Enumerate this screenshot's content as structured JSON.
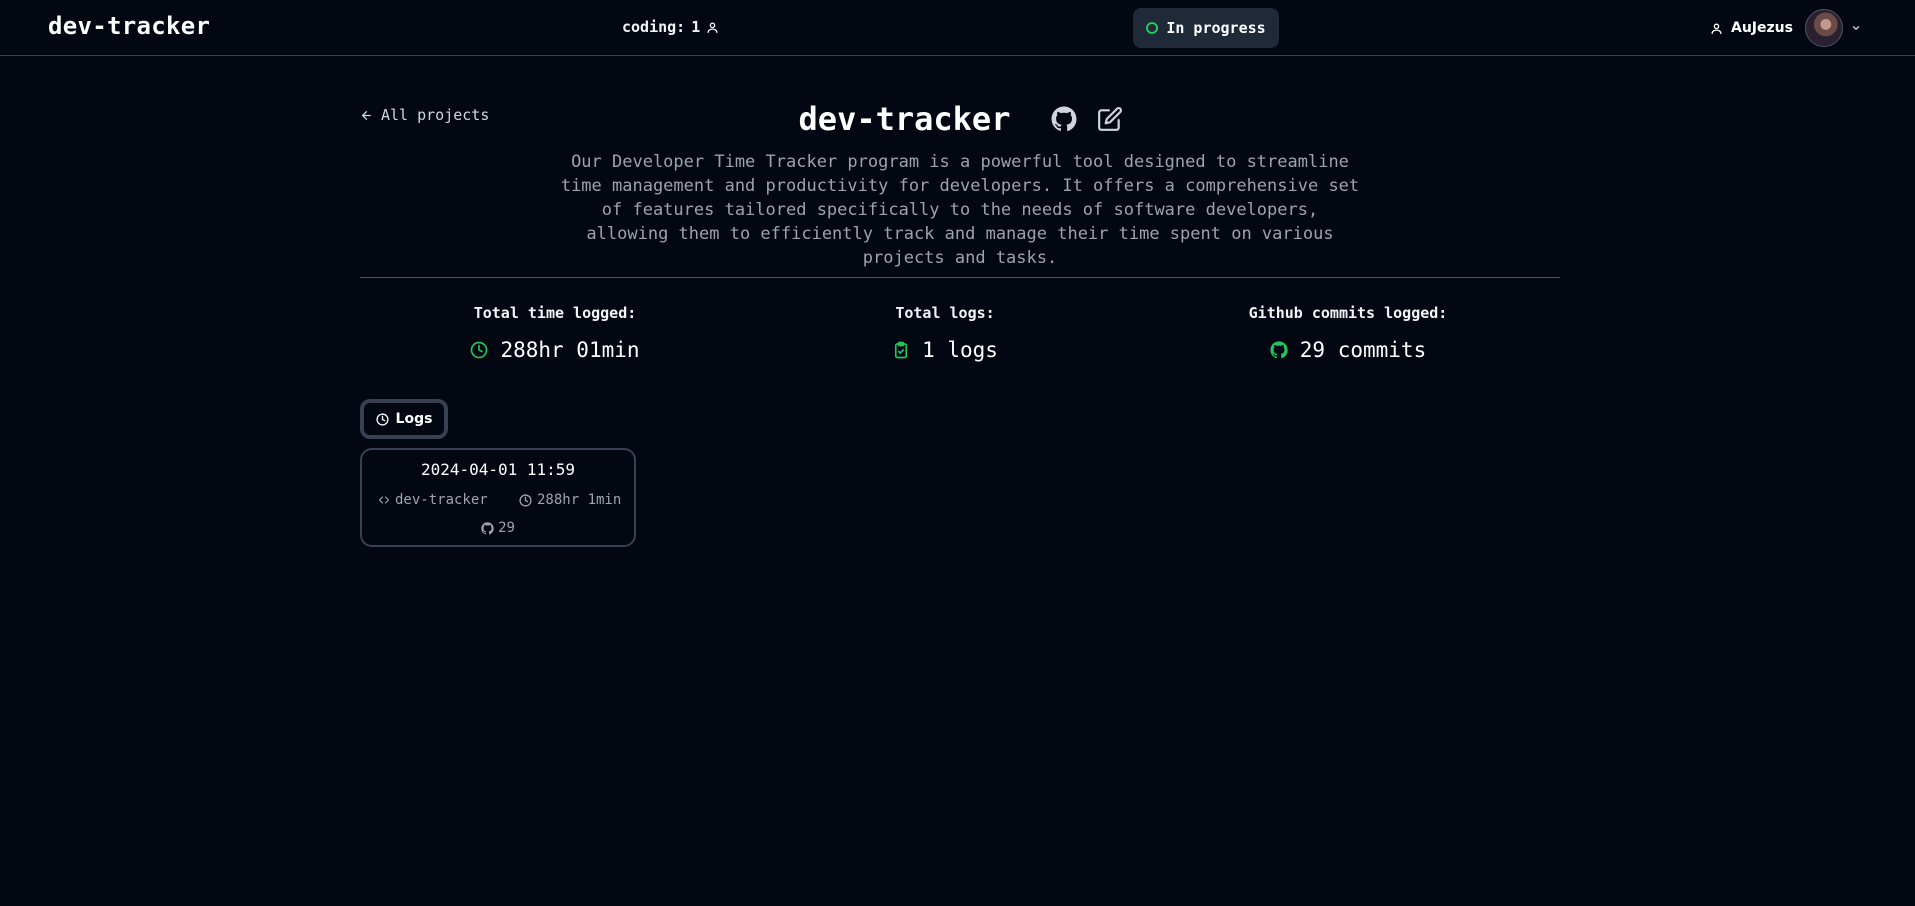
{
  "header": {
    "logo": "dev-tracker",
    "coding_label": "coding:",
    "coding_count": "1",
    "status": "In progress",
    "username": "AuJezus"
  },
  "nav": {
    "back_label": "All projects"
  },
  "project": {
    "title": "dev-tracker",
    "description": "Our Developer Time Tracker program is a powerful tool designed to streamline time management and productivity for developers. It offers a comprehensive set of features tailored specifically to the needs of software developers, allowing them to efficiently track and manage their time spent on various projects and tasks."
  },
  "stats": [
    {
      "label": "Total time logged:",
      "value": "288hr 01min",
      "icon": "clock-icon"
    },
    {
      "label": "Total logs:",
      "value": "1 logs",
      "icon": "clipboard-check-icon"
    },
    {
      "label": "Github commits logged:",
      "value": "29 commits",
      "icon": "github-icon"
    }
  ],
  "tabs": {
    "logs_label": "Logs"
  },
  "logs": [
    {
      "date": "2024-04-01 11:59",
      "project": "dev-tracker",
      "duration": "288hr 1min",
      "commits": "29"
    }
  ],
  "colors": {
    "background": "#030712",
    "accent": "#22c55e",
    "border": "#374151",
    "muted_text": "#9ca3af"
  }
}
